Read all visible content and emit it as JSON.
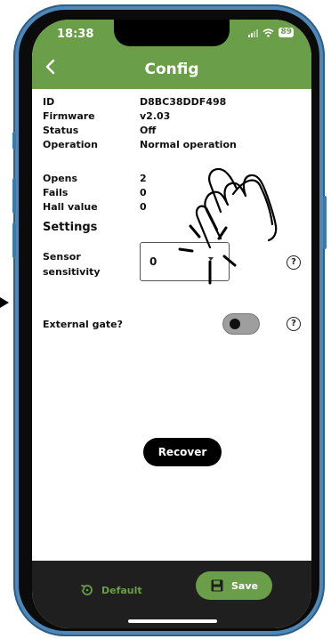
{
  "status_bar": {
    "time": "18:38",
    "battery": "89"
  },
  "header": {
    "back_icon": "chevron-left-icon",
    "title": "Config"
  },
  "info": [
    {
      "label": "ID",
      "value": "D8BC38DDF498"
    },
    {
      "label": "Firmware",
      "value": "v2.03"
    },
    {
      "label": "Status",
      "value": "Off"
    },
    {
      "label": "Operation",
      "value": "Normal operation"
    }
  ],
  "stats": [
    {
      "label": "Opens",
      "value": "2"
    },
    {
      "label": "Fails",
      "value": "0"
    },
    {
      "label": "Hall value",
      "value": "0"
    }
  ],
  "settings": {
    "heading": "Settings",
    "sensor_label_line1": "Sensor",
    "sensor_label_line2": "sensitivity",
    "sensor_value": "0",
    "external_gate_label": "External gate?",
    "external_gate_on": false,
    "help_glyph": "?"
  },
  "recover_label": "Recover",
  "bottom_bar": {
    "default_label": "Default",
    "save_label": "Save"
  },
  "colors": {
    "brand_green": "#6a9e48",
    "phone_blue": "#4d88b8",
    "bar_dark": "#1f1f1f"
  }
}
